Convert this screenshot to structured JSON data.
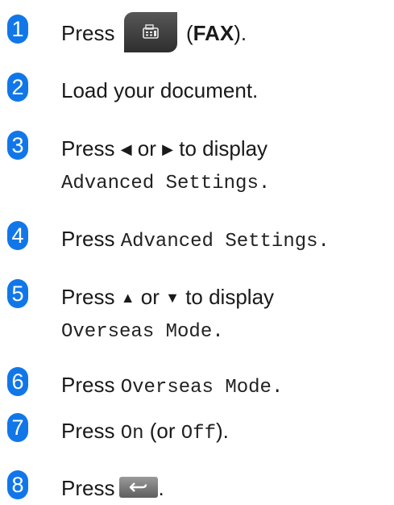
{
  "steps": [
    {
      "number": "1",
      "press": "Press",
      "paren_open": "(",
      "fax_label": "FAX",
      "paren_close": ").",
      "icon": "fax-icon"
    },
    {
      "number": "2",
      "text": "Load your document."
    },
    {
      "number": "3",
      "press": "Press",
      "left_arrow": "◀",
      "or": "or",
      "right_arrow": "▶",
      "to_display": "to display",
      "menu_item": "Advanced Settings",
      "period": "."
    },
    {
      "number": "4",
      "press": "Press",
      "menu_item": "Advanced Settings",
      "period": "."
    },
    {
      "number": "5",
      "press": "Press",
      "up_arrow": "▲",
      "or": "or",
      "down_arrow": "▼",
      "to_display": "to display",
      "menu_item": "Overseas Mode",
      "period": "."
    },
    {
      "number": "6",
      "press": "Press",
      "menu_item": "Overseas Mode",
      "period": "."
    },
    {
      "number": "7",
      "press": "Press",
      "on_label": "On",
      "or_open": "(or",
      "off_label": "Off",
      "close": ")."
    },
    {
      "number": "8",
      "press": "Press",
      "period": ".",
      "icon": "back-arrow-icon"
    }
  ],
  "colors": {
    "badge": "#1177e8",
    "text": "#1a1a1a"
  }
}
